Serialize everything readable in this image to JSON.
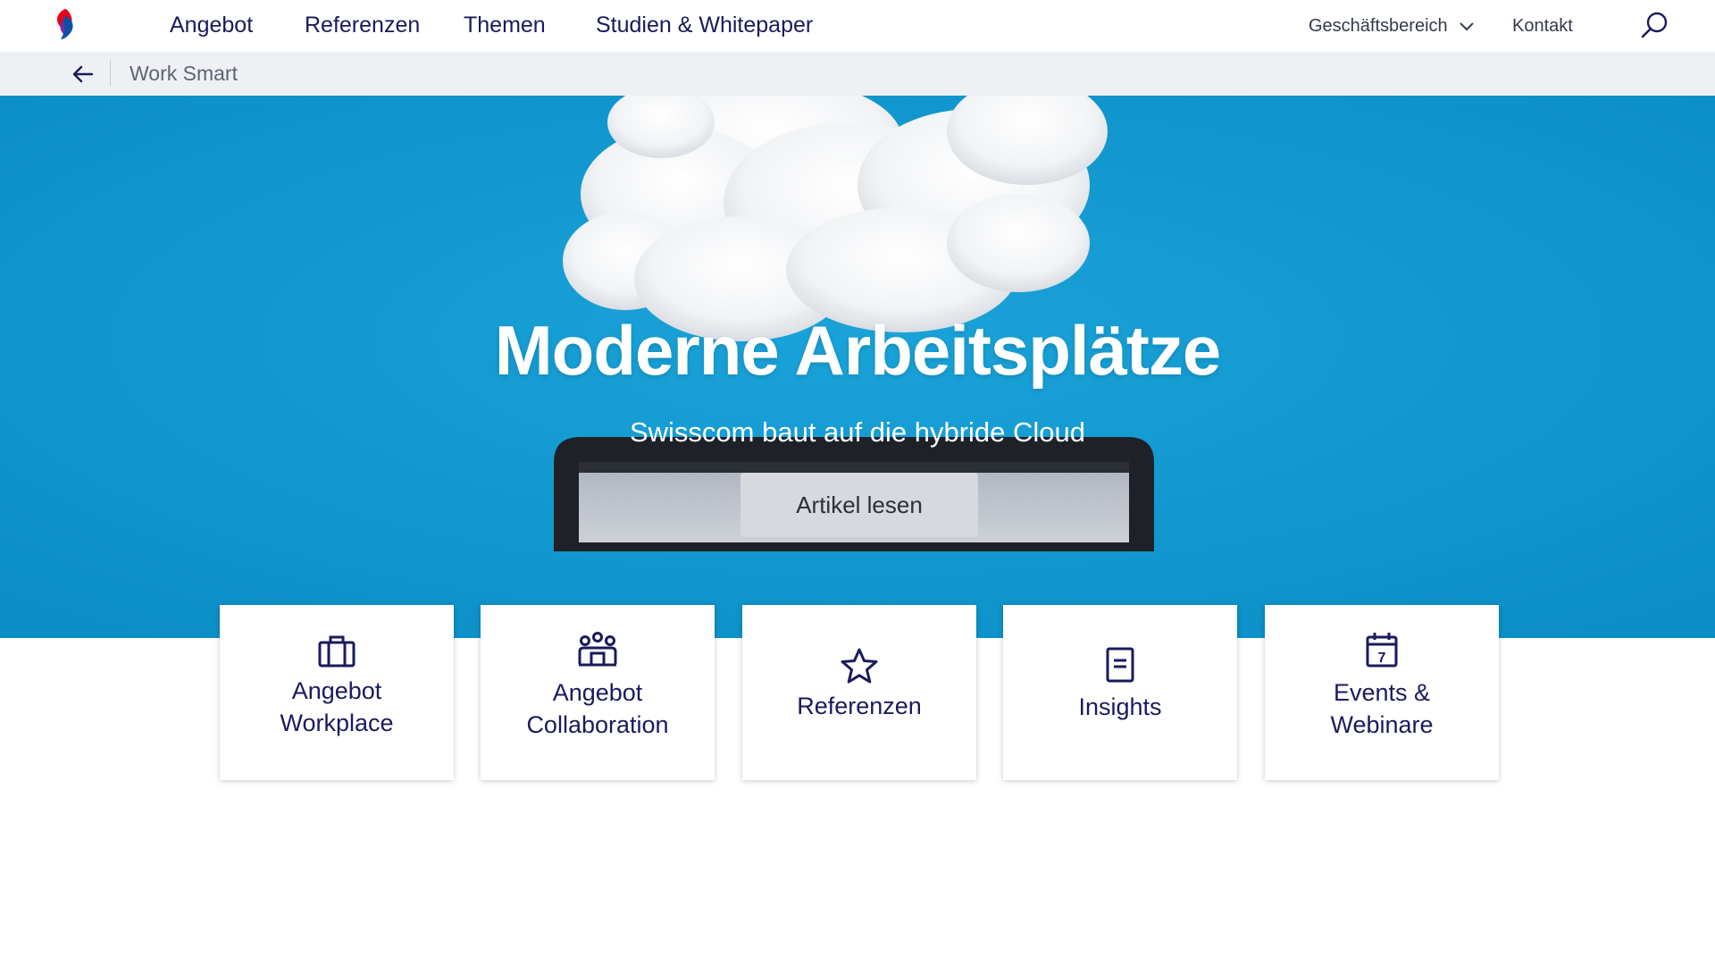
{
  "nav": {
    "items": [
      "Angebot",
      "Referenzen",
      "Themen",
      "Studien & Whitepaper"
    ],
    "business_area": "Geschäftsbereich",
    "contact": "Kontakt"
  },
  "breadcrumb": {
    "label": "Work Smart"
  },
  "hero": {
    "title": "Moderne Arbeitsplätze",
    "subtitle": "Swisscom baut auf die hybride Cloud",
    "cta": "Artikel lesen"
  },
  "cards": [
    {
      "icon": "briefcase-icon",
      "line1": "Angebot",
      "line2": "Workplace"
    },
    {
      "icon": "team-icon",
      "line1": "Angebot",
      "line2": "Collaboration"
    },
    {
      "icon": "star-icon",
      "line1": "Referenzen",
      "line2": ""
    },
    {
      "icon": "document-icon",
      "line1": "Insights",
      "line2": ""
    },
    {
      "icon": "calendar-icon",
      "line1": "Events &",
      "line2": "Webinare",
      "calendar_day": "7"
    }
  ],
  "colors": {
    "brand_navy": "#1a1a5e",
    "hero_blue": "#1197cf",
    "crumb_bg": "#eef1f4",
    "logo_red": "#e3051b",
    "logo_blue": "#0d4fa6"
  }
}
